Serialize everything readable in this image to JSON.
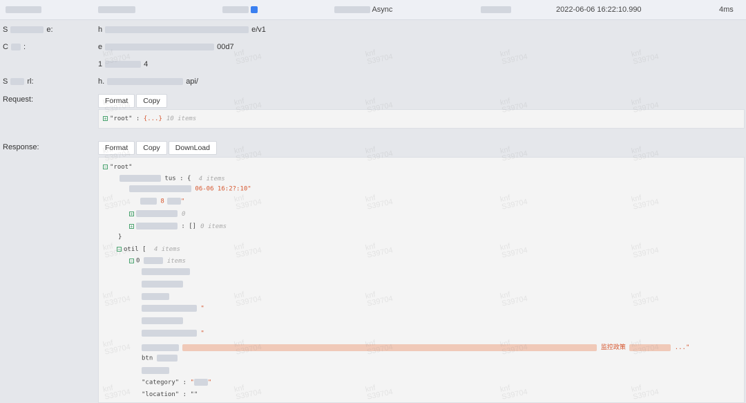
{
  "top_row": {
    "mode": "Async",
    "timestamp": "2022-06-06 16:22:10.990",
    "duration": "4ms"
  },
  "fields": [
    {
      "label": "S",
      "label_tail": "e:",
      "value_prefix": "h",
      "value_suffix": "e/v1"
    },
    {
      "label": "C",
      "label_tail": ":",
      "value_prefix": "e",
      "value_suffix": "00d7"
    },
    {
      "label": "",
      "label_tail": "",
      "value_prefix": "1",
      "value_suffix": "4"
    },
    {
      "label": "S",
      "label_tail": "rl:",
      "value_prefix": "h.",
      "value_suffix": "api/"
    }
  ],
  "request": {
    "label": "Request:",
    "buttons": [
      "Format",
      "Copy"
    ],
    "root_key": "\"root\"",
    "root_preview": "{...}",
    "root_meta": "10 items"
  },
  "response": {
    "label": "Response:",
    "buttons": [
      "Format",
      "Copy",
      "DownLoad"
    ],
    "root_key": "\"root\"",
    "lines": [
      {
        "text": "tus",
        "meta": "4 items"
      },
      {
        "text": "06-06 16:2?:10\"",
        "meta": ""
      },
      {
        "text": "\"",
        "meta": ""
      },
      {
        "text": "",
        "meta": "0"
      },
      {
        "text": "[]",
        "meta": "0 items"
      },
      {
        "text": "}",
        "meta": ""
      },
      {
        "text": "otil",
        "meta": "4 items"
      },
      {
        "text": "0",
        "meta": "items"
      },
      {
        "text": "...",
        "meta": ""
      },
      {
        "text": "\"",
        "meta": ""
      },
      {
        "text": "btn",
        "meta": ""
      },
      {
        "text": "\"category\"",
        "meta": ""
      },
      {
        "text": "\"location\" : \"\"",
        "meta": ""
      }
    ],
    "long_value_suffix": "监控政策"
  },
  "watermark": {
    "line1": "knf",
    "line2": "S39704"
  }
}
